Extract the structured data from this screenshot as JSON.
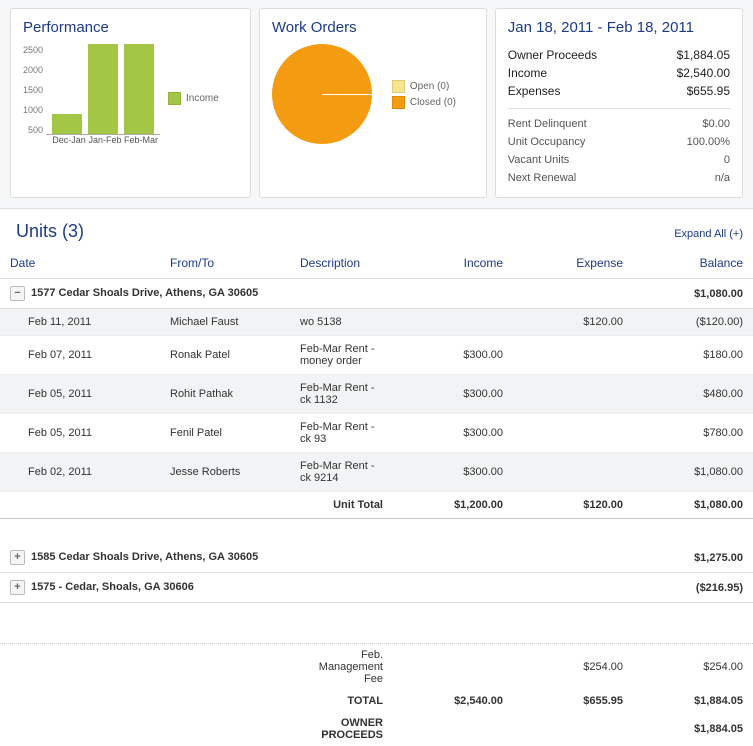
{
  "panels": {
    "performance": {
      "title": "Performance",
      "legend": "Income",
      "legend_color": "#a3c644"
    },
    "workorders": {
      "title": "Work Orders",
      "open_label": "Open (0)",
      "closed_label": "Closed (0)",
      "open_color": "#f6e58d",
      "closed_color": "#f39c12"
    },
    "summary": {
      "date_range": "Jan 18, 2011 - Feb 18, 2011",
      "primary": [
        {
          "label": "Owner Proceeds",
          "value": "$1,884.05"
        },
        {
          "label": "Income",
          "value": "$2,540.00"
        },
        {
          "label": "Expenses",
          "value": "$655.95"
        }
      ],
      "secondary": [
        {
          "label": "Rent Delinquent",
          "value": "$0.00"
        },
        {
          "label": "Unit Occupancy",
          "value": "100.00%"
        },
        {
          "label": "Vacant Units",
          "value": "0"
        },
        {
          "label": "Next Renewal",
          "value": "n/a"
        }
      ]
    }
  },
  "units": {
    "heading": "Units (3)",
    "expand_label": "Expand All (+)",
    "columns": {
      "date": "Date",
      "from": "From/To",
      "desc": "Description",
      "income": "Income",
      "expense": "Expense",
      "balance": "Balance"
    },
    "unit1": {
      "name": "1577 Cedar Shoals Drive, Athens, GA 30605",
      "balance": "$1,080.00",
      "rows": [
        {
          "date": "Feb 11, 2011",
          "from": "Michael Faust",
          "desc": "wo 5138",
          "income": "",
          "expense": "$120.00",
          "balance": "($120.00)"
        },
        {
          "date": "Feb 07, 2011",
          "from": "Ronak Patel",
          "desc": "Feb-Mar Rent - money order",
          "income": "$300.00",
          "expense": "",
          "balance": "$180.00"
        },
        {
          "date": "Feb 05, 2011",
          "from": "Rohit Pathak",
          "desc": "Feb-Mar Rent - ck 1132",
          "income": "$300.00",
          "expense": "",
          "balance": "$480.00"
        },
        {
          "date": "Feb 05, 2011",
          "from": "Fenil Patel",
          "desc": "Feb-Mar Rent - ck 93",
          "income": "$300.00",
          "expense": "",
          "balance": "$780.00"
        },
        {
          "date": "Feb 02, 2011",
          "from": "Jesse Roberts",
          "desc": "Feb-Mar Rent - ck 9214",
          "income": "$300.00",
          "expense": "",
          "balance": "$1,080.00"
        }
      ],
      "totals": {
        "label": "Unit Total",
        "income": "$1,200.00",
        "expense": "$120.00",
        "balance": "$1,080.00"
      }
    },
    "unit2": {
      "name": "1585 Cedar Shoals Drive, Athens, GA 30605",
      "balance": "$1,275.00"
    },
    "unit3": {
      "name": "1575 - Cedar, Shoals, GA 30606",
      "balance": "($216.95)"
    }
  },
  "bottom": {
    "fee": {
      "label": "Feb. Management Fee",
      "expense": "$254.00",
      "balance": "$254.00"
    },
    "total": {
      "label": "TOTAL",
      "income": "$2,540.00",
      "expense": "$655.95",
      "balance": "$1,884.05"
    },
    "owner": {
      "label": "OWNER PROCEEDS",
      "balance": "$1,884.05"
    }
  },
  "chart_data": {
    "type": "bar",
    "categories": [
      "Dec-Jan",
      "Jan-Feb",
      "Feb-Mar"
    ],
    "values": [
      560,
      2540,
      2540
    ],
    "series_name": "Income",
    "ylim": [
      0,
      2500
    ],
    "yticks": [
      500,
      1000,
      1500,
      2000,
      2500
    ]
  }
}
